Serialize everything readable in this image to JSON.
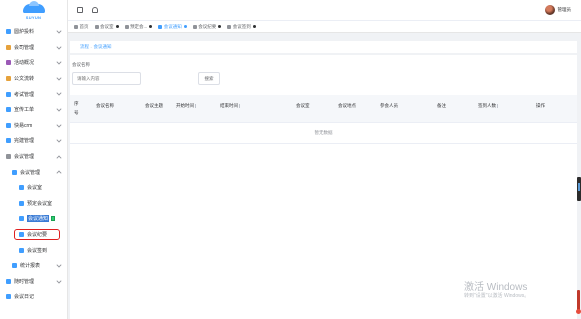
{
  "logo": {
    "text": "SUYUN"
  },
  "sidebar": {
    "items": [
      {
        "label": "圆炉投料",
        "icon": "box-icon",
        "color": "#409eff",
        "level": 0,
        "arrow": "down"
      },
      {
        "label": "会司管理",
        "icon": "company-icon",
        "color": "#e6a23c",
        "level": 0,
        "arrow": "down"
      },
      {
        "label": "活动概况",
        "icon": "chart-icon",
        "color": "#9b59b6",
        "level": 0,
        "arrow": "down"
      },
      {
        "label": "公文流转",
        "icon": "doc-icon",
        "color": "#e6a23c",
        "level": 0,
        "arrow": "down"
      },
      {
        "label": "考试管理",
        "icon": "exam-icon",
        "color": "#409eff",
        "level": 0,
        "arrow": "down"
      },
      {
        "label": "宣传工单",
        "icon": "ticket-icon",
        "color": "#409eff",
        "level": 0,
        "arrow": "down"
      },
      {
        "label": "快易crm",
        "icon": "crm-icon",
        "color": "#409eff",
        "level": 0,
        "arrow": "down"
      },
      {
        "label": "完建管理",
        "icon": "build-icon",
        "color": "#409eff",
        "level": 0,
        "arrow": "down"
      },
      {
        "label": "会议管理",
        "icon": "meeting-icon",
        "color": "#909399",
        "level": 0,
        "arrow": "up"
      },
      {
        "label": "会议管理",
        "icon": "folder-icon",
        "color": "#409eff",
        "level": 1,
        "arrow": "up"
      },
      {
        "label": "会议室",
        "icon": "room-icon",
        "color": "#409eff",
        "level": 2,
        "arrow": ""
      },
      {
        "label": "预定会议室",
        "icon": "reserve-icon",
        "color": "#409eff",
        "level": 2,
        "arrow": ""
      },
      {
        "label": "会议通知",
        "icon": "speaker-icon",
        "color": "#409eff",
        "level": 2,
        "arrow": "",
        "active": true
      },
      {
        "label": "会议纪要",
        "icon": "minutes-icon",
        "color": "#409eff",
        "level": 2,
        "arrow": ""
      },
      {
        "label": "会议签到",
        "icon": "signin-icon",
        "color": "#409eff",
        "level": 2,
        "arrow": ""
      },
      {
        "label": "统计报表",
        "icon": "report-icon",
        "color": "#409eff",
        "level": 1,
        "arrow": "down"
      },
      {
        "label": "随时管理",
        "icon": "time-icon",
        "color": "#409eff",
        "level": 0,
        "arrow": "down"
      },
      {
        "label": "会议日记",
        "icon": "diary-icon",
        "color": "#409eff",
        "level": 0,
        "arrow": ""
      }
    ]
  },
  "header": {
    "username": "管理员"
  },
  "tags": [
    {
      "label": "首页",
      "icon": "home-icon",
      "closable": false,
      "active": false
    },
    {
      "label": "会议室",
      "icon": "room-icon",
      "closable": true,
      "active": false
    },
    {
      "label": "预定会...",
      "icon": "reserve-icon",
      "closable": true,
      "active": false
    },
    {
      "label": "会议通知",
      "icon": "speaker-icon",
      "closable": true,
      "active": true
    },
    {
      "label": "会议纪要",
      "icon": "minutes-icon",
      "closable": true,
      "active": false
    },
    {
      "label": "会议签到",
      "icon": "signin-icon",
      "closable": true,
      "active": false
    }
  ],
  "breadcrumb": {
    "root": "流程",
    "sep": "-",
    "current": "会议通知"
  },
  "search": {
    "label": "会议名称",
    "placeholder": "请输入内容",
    "button": "搜索"
  },
  "table": {
    "columns": [
      "序号",
      "会议名称",
      "会议主题",
      "开始时间",
      "结束时间",
      "会议室",
      "会议地点",
      "参会人员",
      "备注",
      "签到人数",
      "操作"
    ],
    "empty_text": "暂无数据"
  },
  "watermark": {
    "title": "激活 Windows",
    "subtitle": "转到\"设置\"以激活 Windows。"
  },
  "colors": {
    "accent": "#409eff",
    "highlight_border": "#e02020"
  }
}
